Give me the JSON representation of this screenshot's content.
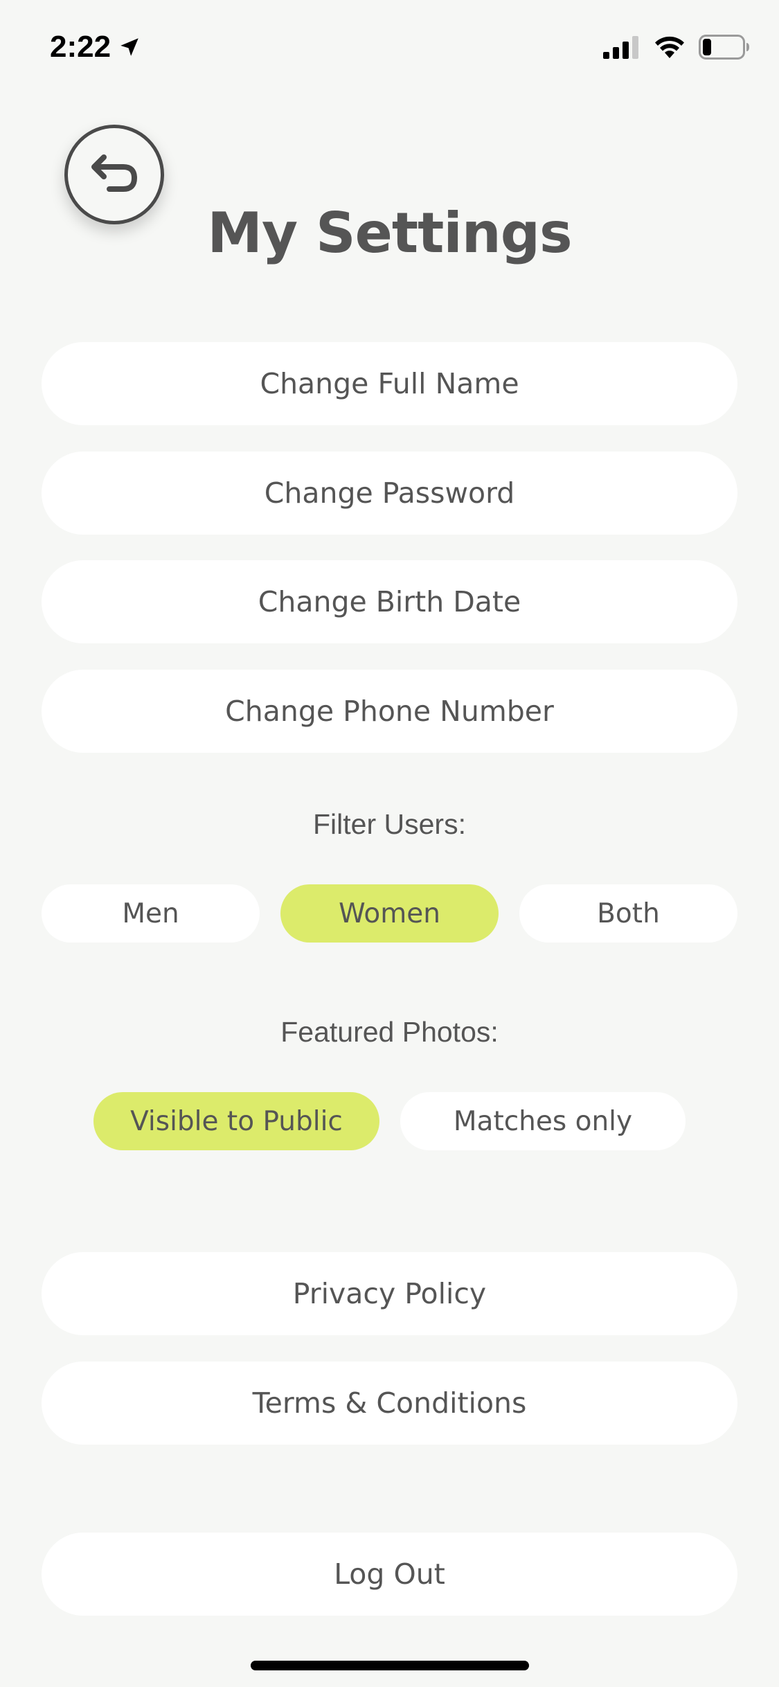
{
  "status_bar": {
    "time": "2:22"
  },
  "header": {
    "title": "My Settings",
    "back_icon": "back-arrow-icon"
  },
  "account_actions": [
    {
      "label": "Change Full Name"
    },
    {
      "label": "Change Password"
    },
    {
      "label": "Change Birth Date"
    },
    {
      "label": "Change Phone Number"
    }
  ],
  "filter_users": {
    "label": "Filter Users:",
    "options": [
      "Men",
      "Women",
      "Both"
    ],
    "selected": "Women"
  },
  "featured_photos": {
    "label": "Featured Photos:",
    "options": [
      "Visible to Public",
      "Matches only"
    ],
    "selected": "Visible to Public"
  },
  "legal": {
    "privacy": "Privacy Policy",
    "terms": "Terms & Conditions"
  },
  "logout_label": "Log Out",
  "colors": {
    "accent": "#dceb6b",
    "background": "#f6f7f5",
    "text": "#555555"
  }
}
